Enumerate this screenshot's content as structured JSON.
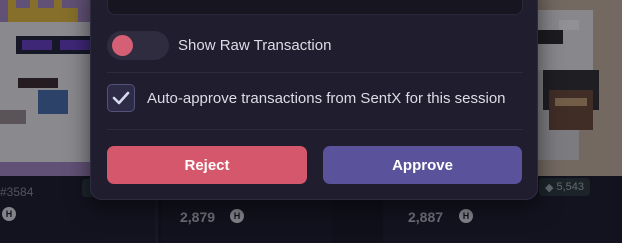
{
  "gallery": {
    "cards": [
      {
        "number": "#3584",
        "price": ""
      },
      {
        "number": "",
        "price": "2,879"
      },
      {
        "number": "",
        "price": "2,887",
        "badge": "5,543"
      }
    ],
    "currency_symbol": "H"
  },
  "modal": {
    "raw_transaction_toggle": {
      "label": "Show Raw Transaction",
      "on": false
    },
    "auto_approve": {
      "label": "Auto-approve transactions from SentX for this session",
      "checked": true
    },
    "buttons": {
      "reject": "Reject",
      "approve": "Approve"
    }
  },
  "colors": {
    "reject": "#d5576b",
    "approve": "#5a529a",
    "toggle_knob": "#d55f75",
    "modal_bg": "#1f1d2e"
  },
  "icons": {
    "checkbox_mark": "checkmark-icon",
    "currency": "hbar-coin-icon",
    "badge": "gem-icon"
  }
}
